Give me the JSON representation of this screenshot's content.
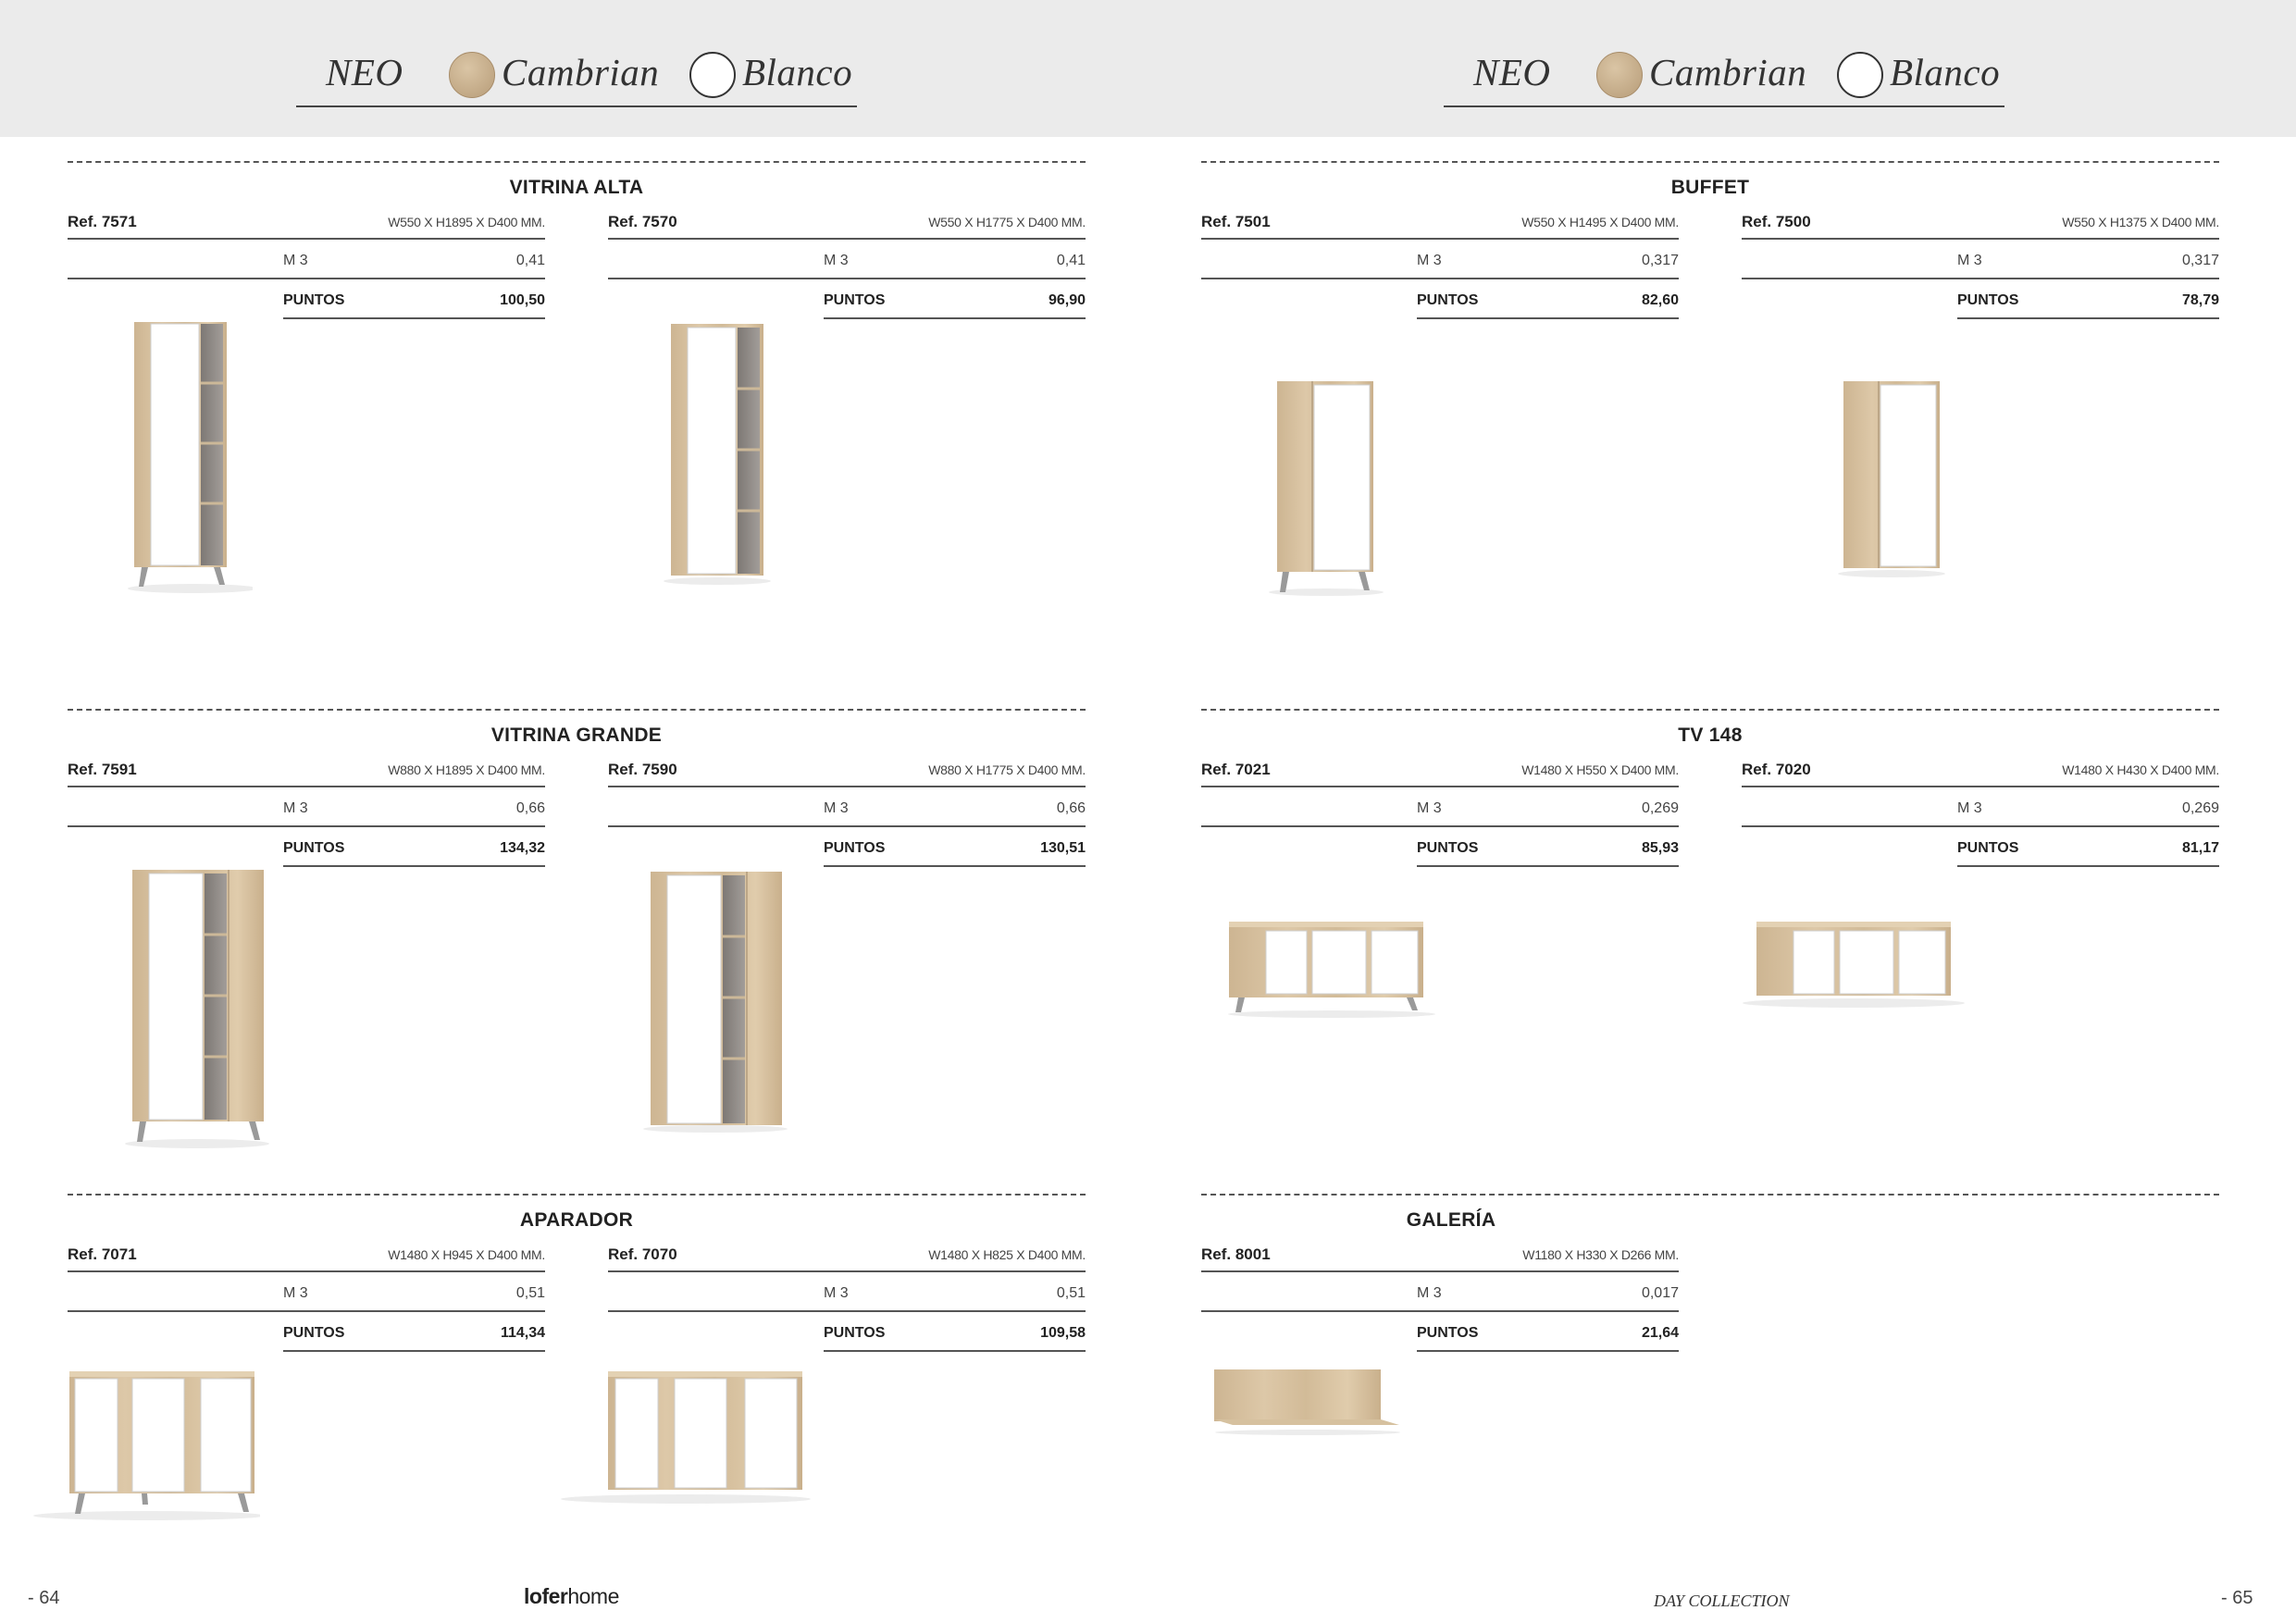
{
  "header": {
    "left": {
      "collection": "NEO",
      "finish1": "Cambrian",
      "finish2": "Blanco"
    },
    "right": {
      "collection": "NEO",
      "finish1": "Cambrian",
      "finish2": "Blanco"
    }
  },
  "sections": [
    {
      "title": "VITRINA ALTA",
      "products": [
        {
          "ref": "Ref. 7571",
          "dims": "W550 X H1895 X D400  MM.",
          "m3_label": "M 3",
          "m3": "0,41",
          "pts_label": "PUNTOS",
          "pts": "100,50"
        },
        {
          "ref": "Ref. 7570",
          "dims": "W550 X H1775 X D400  MM.",
          "m3_label": "M 3",
          "m3": "0,41",
          "pts_label": "PUNTOS",
          "pts": "96,90"
        }
      ]
    },
    {
      "title": "BUFFET",
      "products": [
        {
          "ref": "Ref. 7501",
          "dims": "W550 X H1495 X D400  MM.",
          "m3_label": "M 3",
          "m3": "0,317",
          "pts_label": "PUNTOS",
          "pts": "82,60"
        },
        {
          "ref": "Ref. 7500",
          "dims": "W550 X H1375 X D400  MM.",
          "m3_label": "M 3",
          "m3": "0,317",
          "pts_label": "PUNTOS",
          "pts": "78,79"
        }
      ]
    },
    {
      "title": "VITRINA GRANDE",
      "products": [
        {
          "ref": "Ref. 7591",
          "dims": "W880 X H1895 X D400  MM.",
          "m3_label": "M 3",
          "m3": "0,66",
          "pts_label": "PUNTOS",
          "pts": "134,32"
        },
        {
          "ref": "Ref. 7590",
          "dims": "W880 X H1775 X D400  MM.",
          "m3_label": "M 3",
          "m3": "0,66",
          "pts_label": "PUNTOS",
          "pts": "130,51"
        }
      ]
    },
    {
      "title": "TV 148",
      "products": [
        {
          "ref": "Ref. 7021",
          "dims": "W1480 X H550 X D400  MM.",
          "m3_label": "M 3",
          "m3": "0,269",
          "pts_label": "PUNTOS",
          "pts": "85,93"
        },
        {
          "ref": "Ref. 7020",
          "dims": "W1480 X H430 X D400  MM.",
          "m3_label": "M 3",
          "m3": "0,269",
          "pts_label": "PUNTOS",
          "pts": "81,17"
        }
      ]
    },
    {
      "title": "APARADOR",
      "products": [
        {
          "ref": "Ref. 7071",
          "dims": "W1480 X H945 X D400  MM.",
          "m3_label": "M 3",
          "m3": "0,51",
          "pts_label": "PUNTOS",
          "pts": "114,34"
        },
        {
          "ref": "Ref. 7070",
          "dims": "W1480 X H825 X D400  MM.",
          "m3_label": "M 3",
          "m3": "0,51",
          "pts_label": "PUNTOS",
          "pts": "109,58"
        }
      ]
    },
    {
      "title": "GALERÍA",
      "products": [
        {
          "ref": "Ref. 8001",
          "dims": "W1180 X H330 X D266  MM.",
          "m3_label": "M 3",
          "m3": "0,017",
          "pts_label": "PUNTOS",
          "pts": "21,64"
        }
      ]
    }
  ],
  "footer": {
    "left_page": "- 64",
    "brand_bold": "lofer",
    "brand_light": "home",
    "collection": "DAY COLLECTION",
    "right_page": "- 65"
  },
  "colors": {
    "band": "#ebebeb",
    "wood": "#d8c3a2",
    "white_door": "#ffffff",
    "glass": "#8f8985",
    "legs": "#9a9a9a"
  }
}
